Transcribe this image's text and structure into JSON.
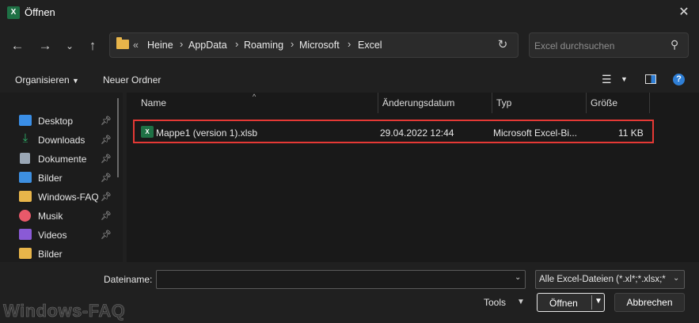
{
  "window": {
    "title": "Öffnen",
    "app_icon_letter": "X"
  },
  "nav": {
    "back_icon": "arrow-left-icon",
    "forward_icon": "arrow-right-icon",
    "recent_icon": "chevron-down-icon",
    "up_icon": "arrow-up-icon"
  },
  "address": {
    "overflow": "«",
    "crumbs": [
      "Heine",
      "AppData",
      "Roaming",
      "Microsoft",
      "Excel"
    ],
    "separator": "›"
  },
  "search": {
    "placeholder": "Excel durchsuchen"
  },
  "toolbar": {
    "organize_label": "Organisieren",
    "new_folder_label": "Neuer Ordner",
    "help_label": "?"
  },
  "sidebar": {
    "items": [
      {
        "label": "Desktop",
        "icon": "desktop-icon",
        "color": "#3a8ee6",
        "pinned": true
      },
      {
        "label": "Downloads",
        "icon": "download-icon",
        "color": "#2fb56b",
        "pinned": true
      },
      {
        "label": "Dokumente",
        "icon": "document-icon",
        "color": "#9aa7b5",
        "pinned": true
      },
      {
        "label": "Bilder",
        "icon": "pictures-icon",
        "color": "#3d8fe0",
        "pinned": true
      },
      {
        "label": "Windows-FAQ",
        "icon": "folder-icon",
        "color": "#e8b54a",
        "pinned": true
      },
      {
        "label": "Musik",
        "icon": "music-icon",
        "color": "#e8596a",
        "pinned": true
      },
      {
        "label": "Videos",
        "icon": "video-icon",
        "color": "#8a5ad6",
        "pinned": true
      },
      {
        "label": "Bilder",
        "icon": "folder-icon",
        "color": "#e8b54a",
        "pinned": false
      }
    ]
  },
  "columns": {
    "name": "Name",
    "date": "Änderungsdatum",
    "type": "Typ",
    "size": "Größe"
  },
  "files": [
    {
      "name": "Mappe1 (version 1).xlsb",
      "date": "29.04.2022 12:44",
      "type": "Microsoft Excel-Bi...",
      "size": "11 KB"
    }
  ],
  "bottom": {
    "filename_label": "Dateiname:",
    "filename_value": "",
    "filter_value": "Alle Excel-Dateien (*.xl*;*.xlsx;*",
    "tools_label": "Tools",
    "open_label": "Öffnen",
    "cancel_label": "Abbrechen"
  },
  "watermark": "Windows-FAQ"
}
